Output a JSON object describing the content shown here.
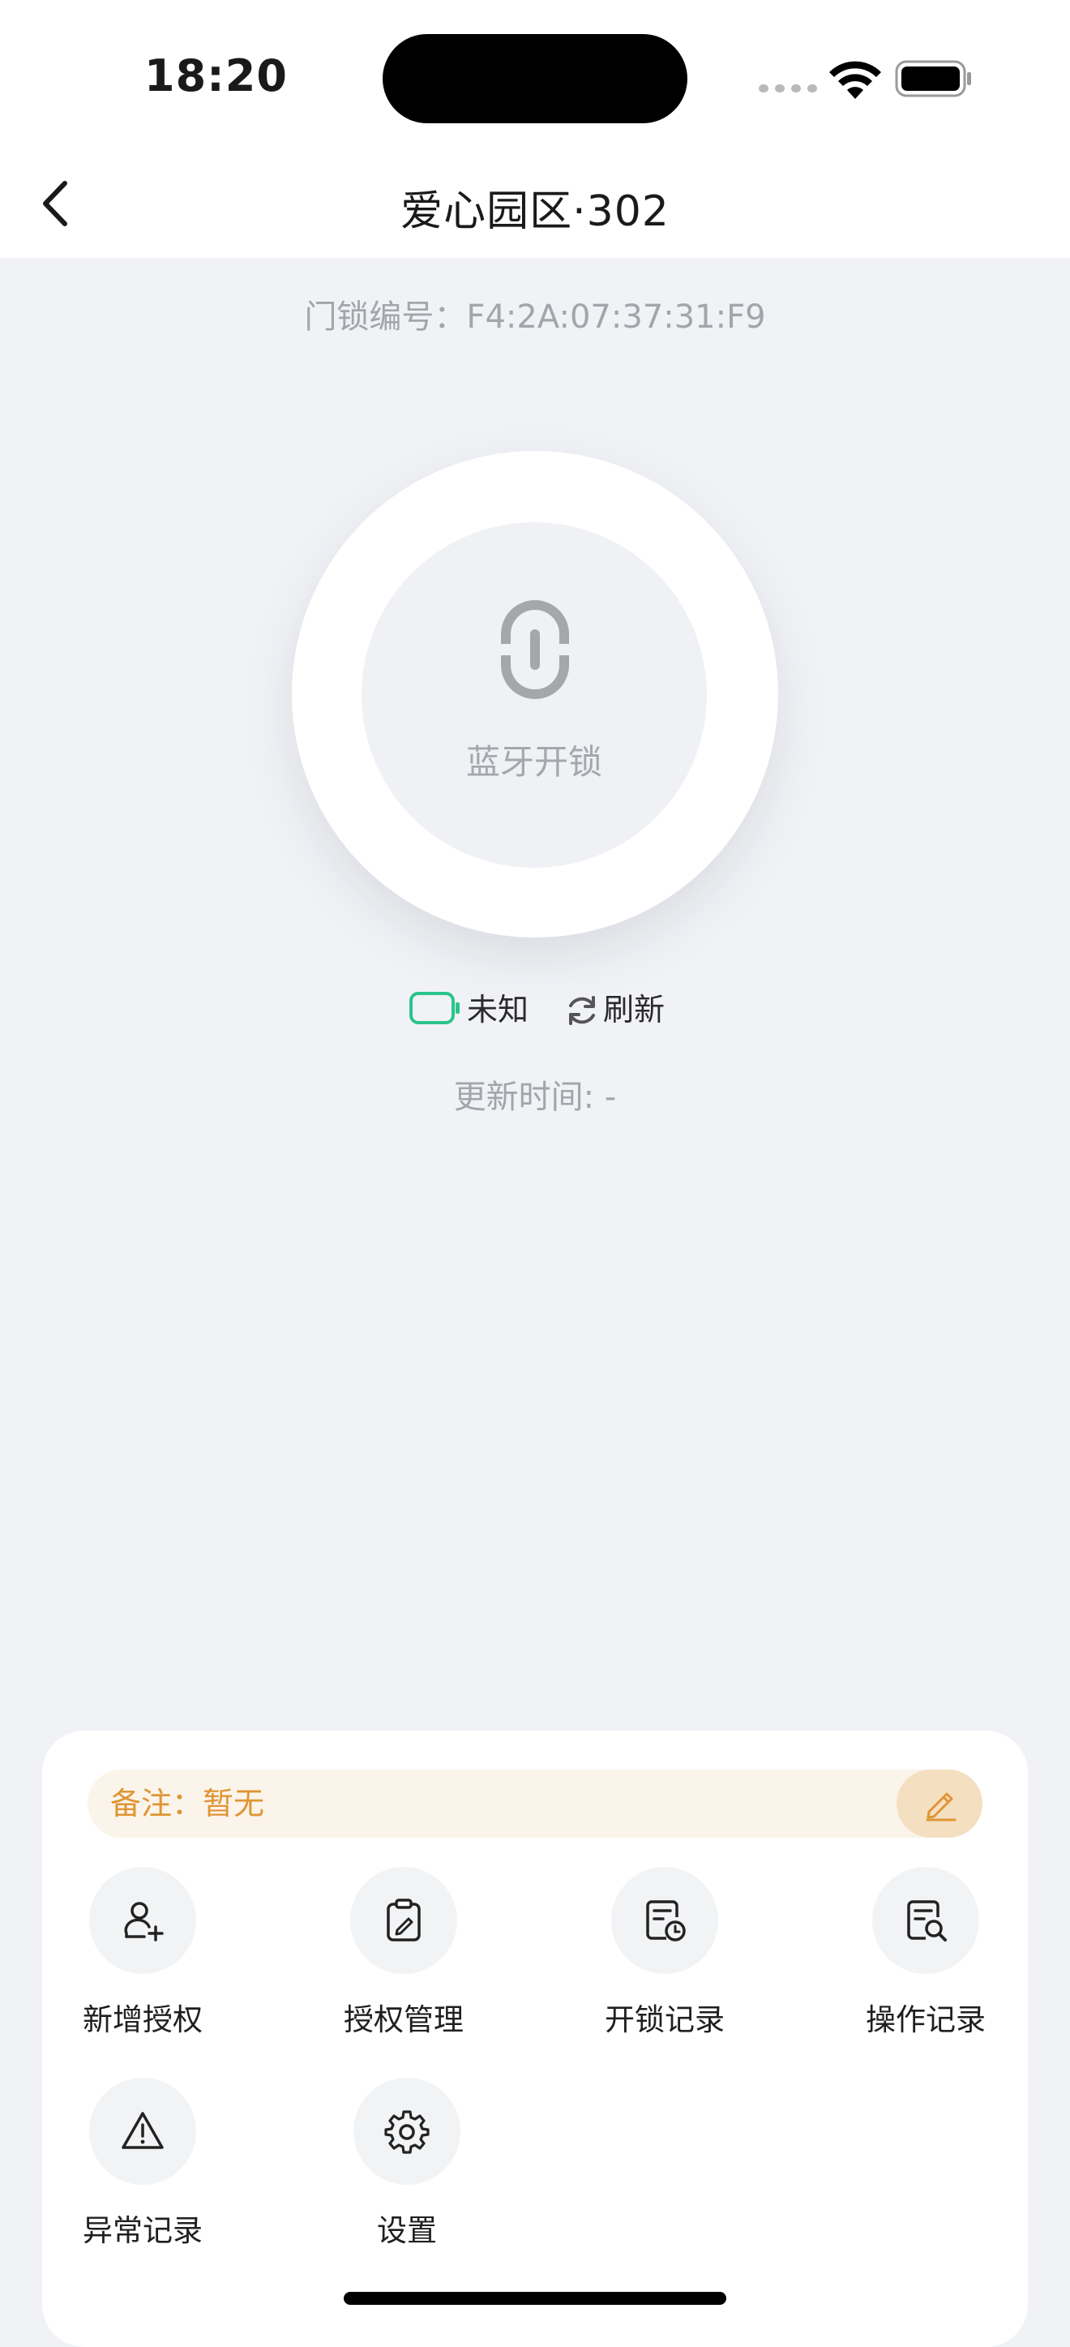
{
  "status_bar": {
    "time": "18:20"
  },
  "nav": {
    "title": "爱心园区·302"
  },
  "lock": {
    "id_text": "门锁编号：F4:2A:07:37:31:F9",
    "unlock_label": "蓝牙开锁",
    "battery_status": "未知",
    "refresh_label": "刷新",
    "update_time": "更新时间: -"
  },
  "panel": {
    "note_text": "备注：暂无",
    "actions": [
      {
        "label": "新增授权",
        "icon": "add-user-icon"
      },
      {
        "label": "授权管理",
        "icon": "clipboard-edit-icon"
      },
      {
        "label": "开锁记录",
        "icon": "record-clock-icon"
      },
      {
        "label": "操作记录",
        "icon": "record-search-icon"
      },
      {
        "label": "异常记录",
        "icon": "warning-icon"
      },
      {
        "label": "设置",
        "icon": "gear-icon"
      }
    ]
  },
  "colors": {
    "accent_green": "#2bc48a",
    "note_orange": "#df9534",
    "page_bg": "#f1f2f6"
  }
}
